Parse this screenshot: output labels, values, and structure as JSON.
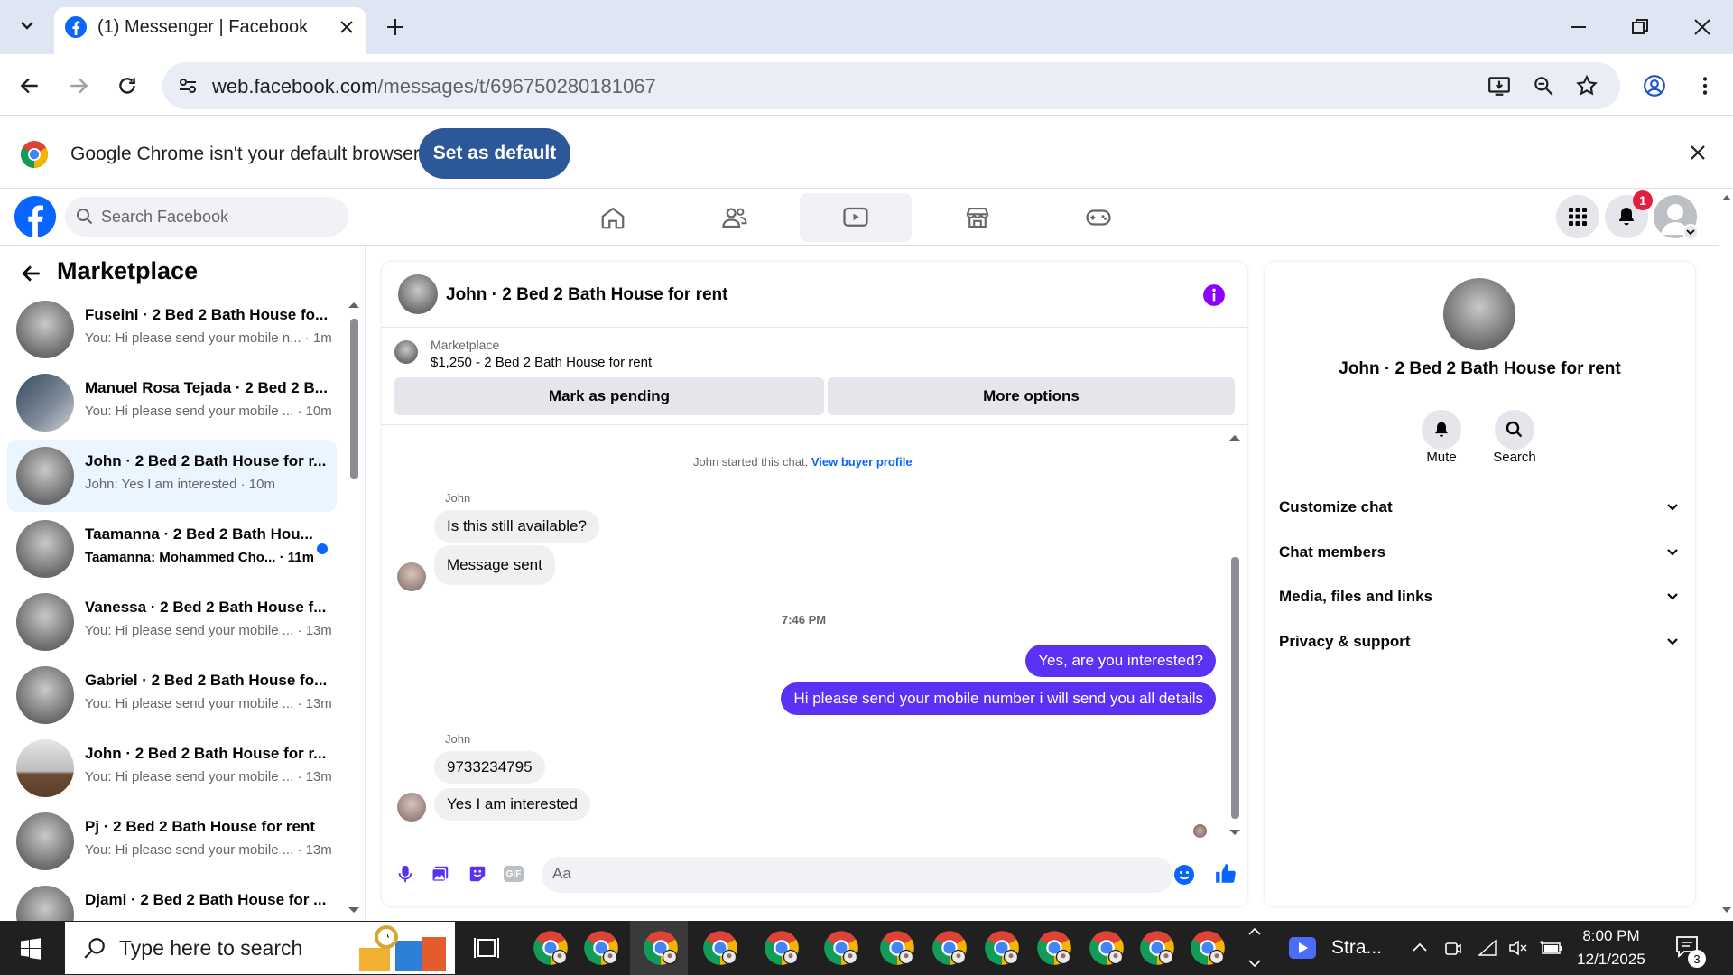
{
  "browser": {
    "tab_title": "(1) Messenger | Facebook",
    "url_host": "web.facebook.com",
    "url_path": "/messages/t/696750280181067",
    "infobar_text": "Google Chrome isn't your default browser",
    "set_default_label": "Set as default"
  },
  "fb": {
    "search_placeholder": "Search Facebook",
    "notification_count": "1"
  },
  "left": {
    "title": "Marketplace",
    "conversations": [
      {
        "name": "Fuseini · 2 Bed 2 Bath House fo...",
        "preview": "You: Hi please send your mobile n...",
        "time": "1m"
      },
      {
        "name": "Manuel Rosa Tejada · 2 Bed 2 B...",
        "preview": "You: Hi please send your mobile ...",
        "time": "10m"
      },
      {
        "name": "John · 2 Bed 2 Bath House for r...",
        "preview": "John: Yes I am interested",
        "time": "10m"
      },
      {
        "name": "Taamanna · 2 Bed 2 Bath Hou...",
        "preview": "Taamanna: Mohammed Cho...",
        "time": "11m"
      },
      {
        "name": "Vanessa · 2 Bed 2 Bath House f...",
        "preview": "You: Hi please send your mobile ...",
        "time": "13m"
      },
      {
        "name": "Gabriel · 2 Bed 2 Bath House fo...",
        "preview": "You: Hi please send your mobile ...",
        "time": "13m"
      },
      {
        "name": "John · 2 Bed 2 Bath House for r...",
        "preview": "You: Hi please send your mobile ...",
        "time": "13m"
      },
      {
        "name": "Pj · 2 Bed 2 Bath House for rent",
        "preview": "You: Hi please send your mobile ...",
        "time": "13m"
      },
      {
        "name": "Djami · 2 Bed 2 Bath House for ...",
        "preview": "",
        "time": ""
      }
    ]
  },
  "chat": {
    "title": "John · 2 Bed 2 Bath House for rent",
    "marketplace_label": "Marketplace",
    "listing": "$1,250 - 2 Bed 2 Bath House for rent",
    "mark_pending": "Mark as pending",
    "more_options": "More options",
    "started_text": "John started this chat.",
    "view_buyer": "View buyer profile",
    "sender1": "John",
    "msg1": "Is this still available?",
    "msg2": "Message sent",
    "time_divider": "7:46 PM",
    "out1": "Yes, are you interested?",
    "out2": "Hi please send your mobile number i will send you all details",
    "sender2": "John",
    "msg3": "9733234795",
    "msg4": "Yes I am interested",
    "composer_placeholder": "Aa"
  },
  "right": {
    "name": "John · 2 Bed 2 Bath House for rent",
    "mute": "Mute",
    "search": "Search",
    "sections": [
      "Customize chat",
      "Chat members",
      "Media, files and links",
      "Privacy & support"
    ]
  },
  "taskbar": {
    "search_placeholder": "Type here to search",
    "app_label": "Stra...",
    "time": "8:00 PM",
    "date": "12/1/2025",
    "notif_count": "3"
  },
  "colors": {
    "messenger_blue": "#5b31f4",
    "fb_blue": "#0866ff",
    "chrome_set_default": "#2c5899"
  }
}
